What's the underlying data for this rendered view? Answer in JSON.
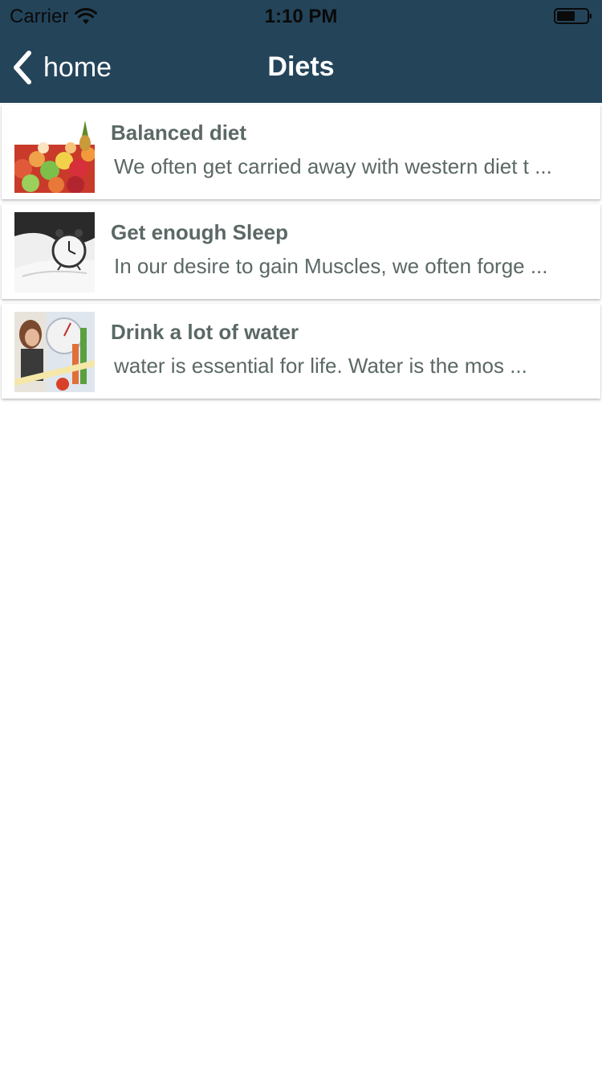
{
  "status_bar": {
    "carrier": "Carrier",
    "time": "1:10 PM",
    "wifi_icon": "wifi-icon",
    "battery_icon": "battery-icon"
  },
  "nav": {
    "back_label": "home",
    "back_icon": "chevron-left-icon",
    "title": "Diets"
  },
  "colors": {
    "header_bg": "#24445a",
    "text_muted": "#5b6866",
    "nav_text": "#ffffff"
  },
  "items": [
    {
      "title": "Balanced diet",
      "snippet": "We often get carried away with western diet t ...",
      "image": "fruit-bowl-image"
    },
    {
      "title": "Get enough Sleep",
      "snippet": "In our desire to gain Muscles, we often forge ...",
      "image": "alarm-clock-bed-image"
    },
    {
      "title": "Drink a lot of water",
      "snippet": "water is essential for life. Water is the mos ...",
      "image": "woman-scale-tape-image"
    }
  ]
}
